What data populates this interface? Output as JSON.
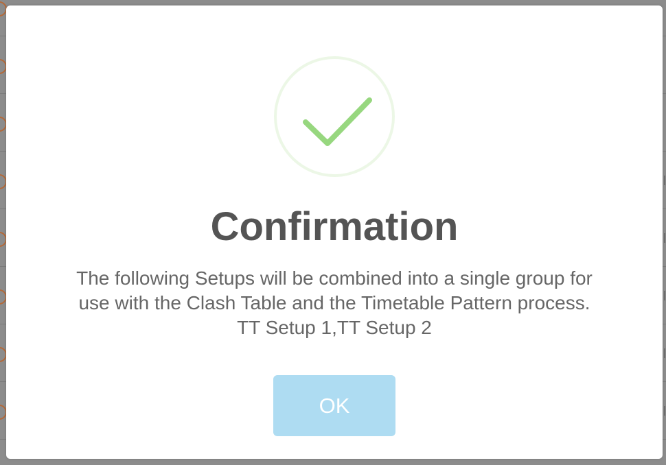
{
  "dialog": {
    "icon": "success-checkmark-icon",
    "title": "Confirmation",
    "message_lines": [
      "The following Setups will be combined into a single group for",
      "use with the Clash Table and the Timetable Pattern process.",
      "TT Setup 1,TT Setup 2"
    ],
    "ok_label": "OK"
  },
  "colors": {
    "overlay": "#8c8c8c",
    "title": "#545454",
    "message": "#666666",
    "check": "#97d77f",
    "ring": "#ecf7e6",
    "button": "#aedcf2",
    "button_text": "#ffffff"
  }
}
